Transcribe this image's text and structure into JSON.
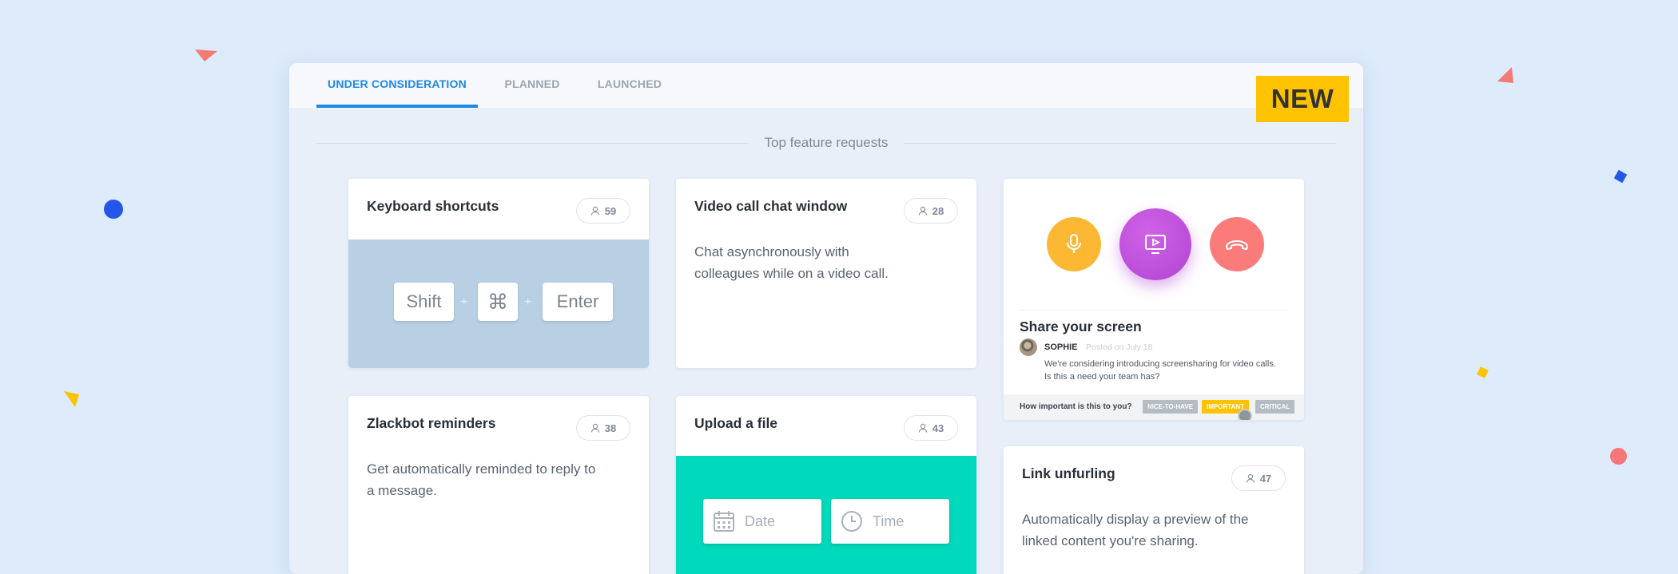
{
  "tabs": [
    {
      "label": "UNDER CONSIDERATION",
      "active": true
    },
    {
      "label": "PLANNED",
      "active": false
    },
    {
      "label": "LAUNCHED",
      "active": false
    }
  ],
  "new_badge": "NEW",
  "section_title": "Top feature requests",
  "cards": {
    "keyboard": {
      "title": "Keyboard shortcuts",
      "votes": "59",
      "keys": [
        "Shift",
        "⌘",
        "Enter"
      ],
      "plus": "+"
    },
    "video": {
      "title": "Video call chat window",
      "votes": "28",
      "description": "Chat asynchronously with colleagues while on a video call."
    },
    "zlackbot": {
      "title": "Zlackbot reminders",
      "votes": "38",
      "description": "Get automatically reminded to reply to a message."
    },
    "upload": {
      "title": "Upload a file",
      "votes": "43",
      "date_placeholder": "Date",
      "time_placeholder": "Time"
    },
    "share": {
      "title": "Share your screen",
      "author": "SOPHIE",
      "posted": "Posted on July 18",
      "description": "We're considering introducing screensharing for video calls. Is this a need your team has?",
      "question": "How important is this to you?",
      "options": [
        "NICE-TO-HAVE",
        "IMPORTANT",
        "CRITICAL"
      ],
      "selected": "IMPORTANT"
    },
    "link": {
      "title": "Link unfurling",
      "votes": "47",
      "description": "Automatically display a preview of the linked content you're sharing."
    }
  },
  "colors": {
    "accent": "#1e88e5",
    "badge": "#fdc200",
    "mic": "#fdb833",
    "screen": "#b84fd8",
    "hangup": "#fb7b7b",
    "upload_bg": "#00d9bb",
    "keyboard_bg": "#b9d0e4"
  },
  "icons": [
    "user-icon",
    "microphone-icon",
    "screen-share-icon",
    "hang-up-icon",
    "calendar-icon",
    "clock-icon"
  ]
}
